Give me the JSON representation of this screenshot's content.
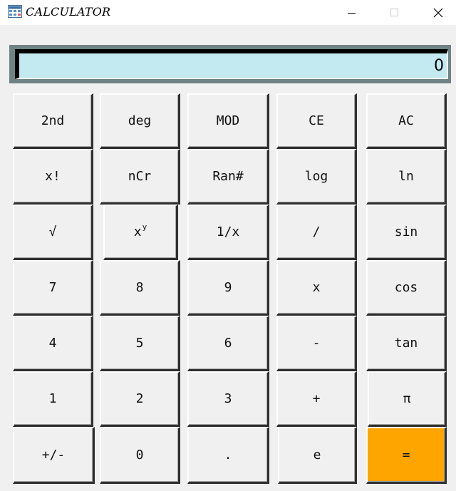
{
  "window": {
    "title": "CALCULATOR",
    "icon": "calculator-icon",
    "controls": {
      "minimize": "minimize-icon",
      "maximize": "maximize-icon",
      "close": "close-icon"
    }
  },
  "display": {
    "value": "0"
  },
  "keypad": {
    "rows": [
      [
        "2nd",
        "deg",
        "MOD",
        "CE",
        "AC"
      ],
      [
        "x!",
        "nCr",
        "Ran#",
        "log",
        "ln"
      ],
      [
        "√",
        "xʸ",
        "1/x",
        "/",
        "sin"
      ],
      [
        "7",
        "8",
        "9",
        "x",
        "cos"
      ],
      [
        "4",
        "5",
        "6",
        "-",
        "tan"
      ],
      [
        "1",
        "2",
        "3",
        "+",
        "π"
      ],
      [
        "+/-",
        "0",
        ".",
        "e",
        "="
      ]
    ],
    "power_key": {
      "base": "x",
      "exp": "y"
    },
    "equals_color": "#ffa500"
  }
}
